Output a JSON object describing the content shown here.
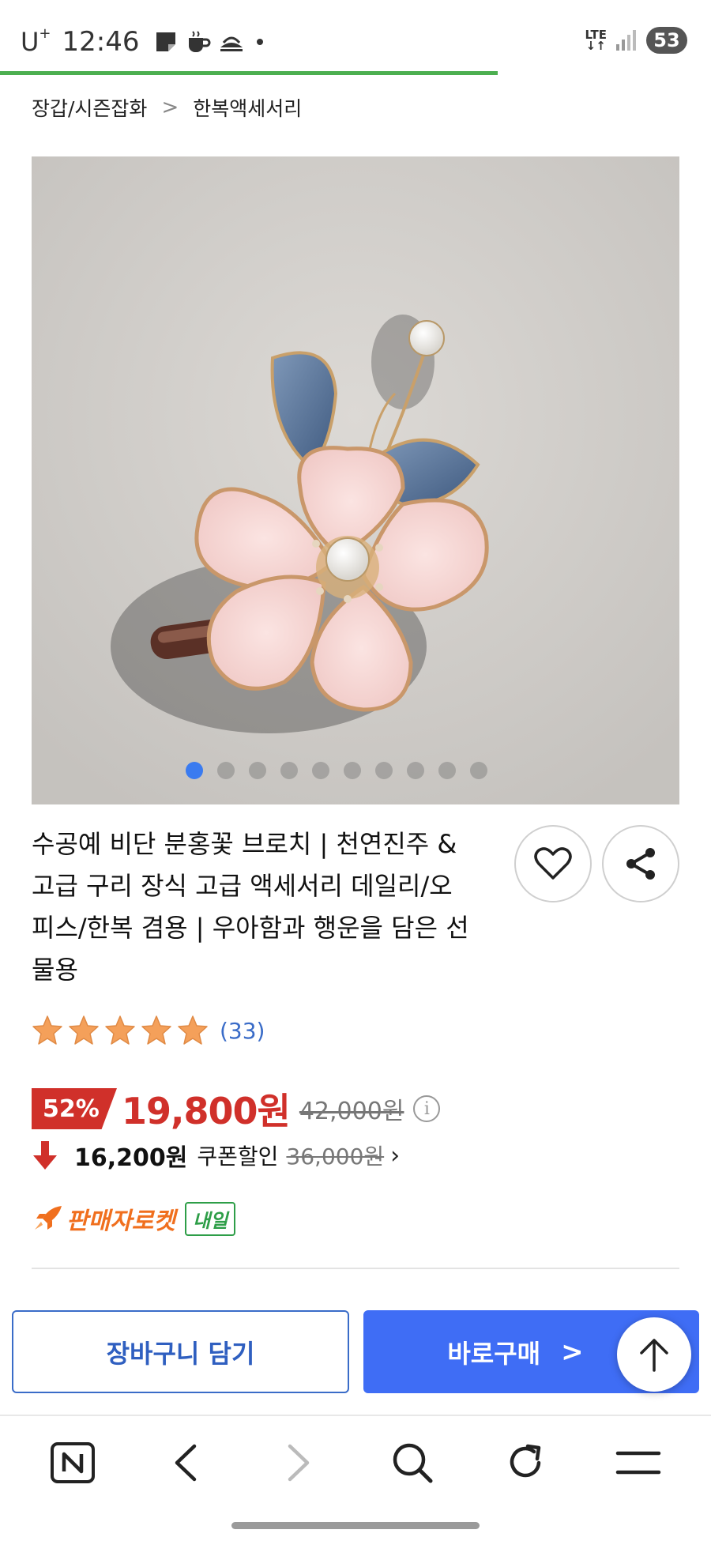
{
  "status_bar": {
    "carrier": "U",
    "carrier_sup": "+",
    "time": "12:46",
    "network": "LTE",
    "battery": "53"
  },
  "page_load_progress": 0.7,
  "breadcrumb": {
    "items": [
      "장갑/시즌잡화",
      "한복액세서리"
    ],
    "separator": ">"
  },
  "product": {
    "image_alt": "분홍꽃 브로치",
    "image_count": 10,
    "active_image_index": 0,
    "title": "수공예 비단 분홍꽃 브로치 | 천연진주 & 고급 구리 장식 고급 액세서리 데일리/오피스/한복 겸용 | 우아함과 행운을 담은 선물용",
    "rating": 5,
    "review_count": "(33)",
    "discount_rate": "52%",
    "sale_price": "19,800원",
    "original_price": "42,000원",
    "coupon_price": "16,200원",
    "coupon_label": "쿠폰할인",
    "coupon_original_price": "36,000원",
    "delivery_label": "판매자로켓",
    "delivery_badge": "내일"
  },
  "actions": {
    "cart_label": "장바구니 담기",
    "buy_label": "바로구매",
    "buy_chevron": ">"
  },
  "icons": {
    "wishlist": "heart-icon",
    "share": "share-icon",
    "scroll_top": "arrow-up-icon",
    "info": "info-icon",
    "coupon_arrow": "arrow-down-icon",
    "rocket": "rocket-icon"
  },
  "colors": {
    "accent_blue": "#3f6df5",
    "discount_red": "#d0302a",
    "rocket_orange": "#f06f1e",
    "badge_green": "#2e9e48",
    "star_orange": "#f4a05a",
    "progress_green": "#4caf50"
  },
  "bottom_nav": {
    "items": [
      "naver-home",
      "back",
      "forward",
      "search",
      "reload",
      "menu"
    ]
  }
}
